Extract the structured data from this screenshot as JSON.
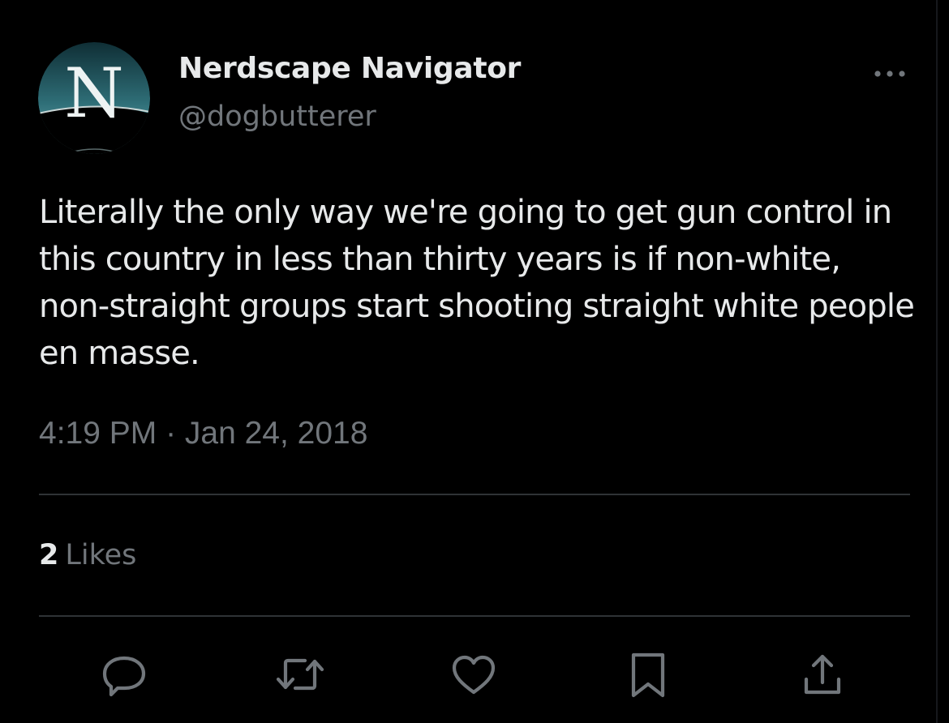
{
  "tweet": {
    "display_name": "Nerdscape Navigator",
    "handle": "@dogbutterer",
    "avatar_letter": "N",
    "text": "Literally the only way we're going to get gun control in this country in less than thirty years is if non-white, non-straight groups start shooting straight white people en masse.",
    "timestamp": "4:19 PM · Jan 24, 2018",
    "likes_count": "2",
    "likes_label": "Likes"
  },
  "actions": [
    {
      "name": "reply",
      "icon": "speech-bubble-icon"
    },
    {
      "name": "retweet",
      "icon": "retweet-icon"
    },
    {
      "name": "like",
      "icon": "heart-icon"
    },
    {
      "name": "bookmark",
      "icon": "bookmark-icon"
    },
    {
      "name": "share",
      "icon": "share-icon"
    }
  ],
  "colors": {
    "background": "#000000",
    "primary_text": "#e7e9ea",
    "secondary_text": "#71767b",
    "divider": "#2f3336",
    "avatar_teal": "#3e7f86"
  }
}
